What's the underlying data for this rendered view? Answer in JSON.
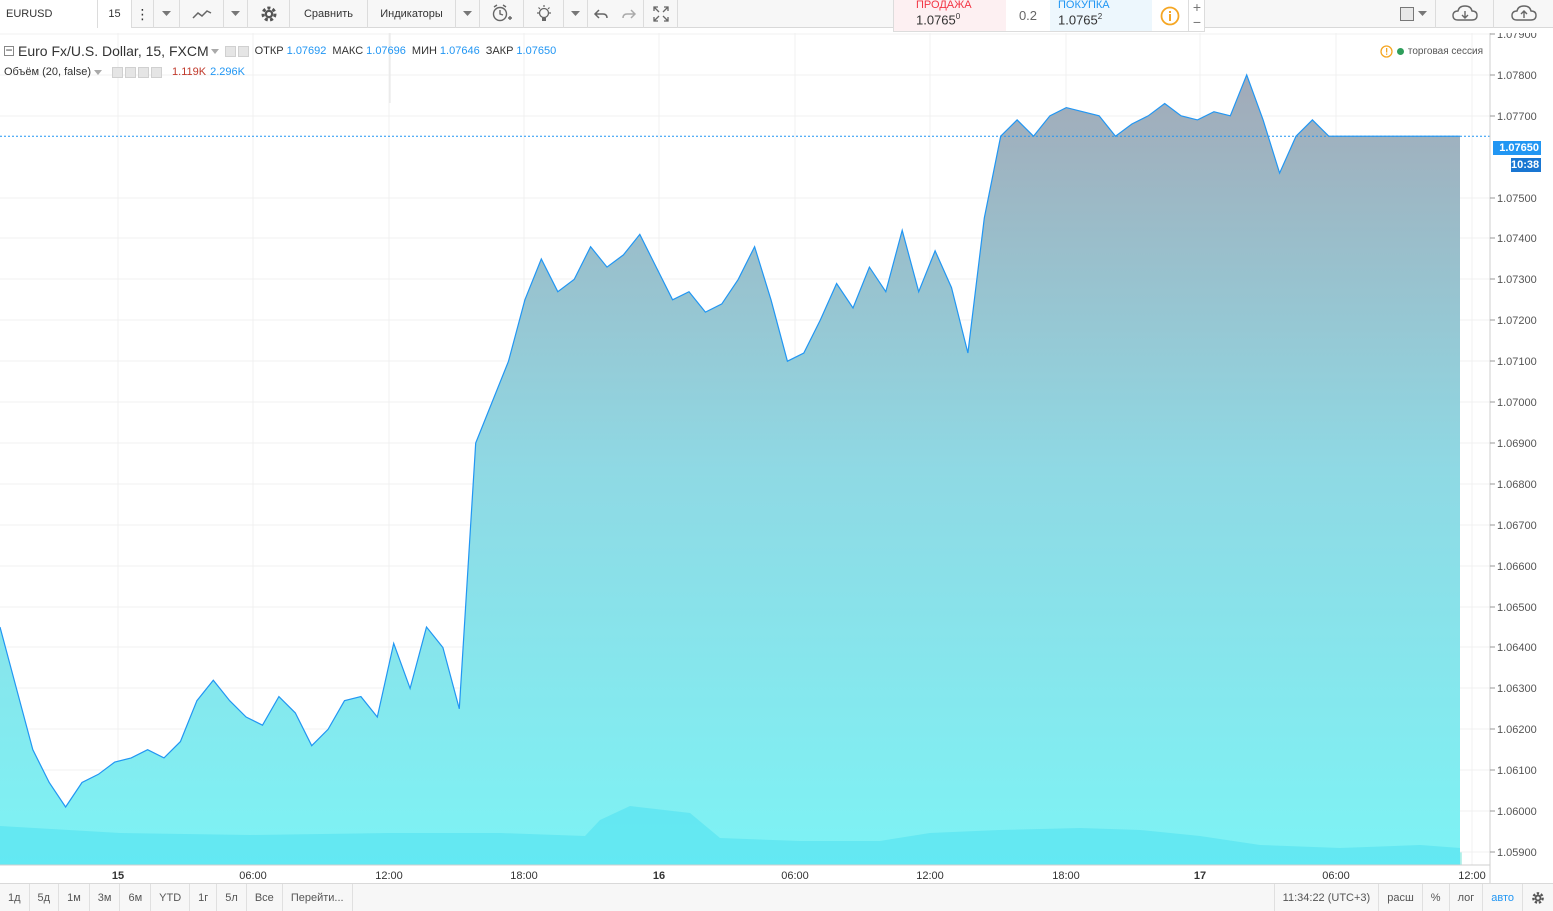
{
  "toolbar": {
    "symbol": "EURUSD",
    "interval": "15",
    "compare_label": "Сравнить",
    "indicators_label": "Индикаторы"
  },
  "quote": {
    "sell_label": "ПРОДАЖА",
    "sell_value": "1.0765",
    "sell_sup": "0",
    "spread": "0.2",
    "buy_label": "ПОКУПКА",
    "buy_value": "1.0765",
    "buy_sup": "2",
    "sell_color": "#f23645",
    "buy_color": "#2196f3"
  },
  "legend": {
    "title": "Euro Fx/U.S. Dollar, 15, FXCM",
    "open_label": "ОТКР",
    "open": "1.07692",
    "high_label": "МАКС",
    "high": "1.07696",
    "low_label": "МИН",
    "low": "1.07646",
    "close_label": "ЗАКР",
    "close": "1.07650",
    "volume_title": "Объём (20, false)",
    "volume_value_1": "1.119K",
    "volume_value_2": "2.296K",
    "session": "торговая сессия"
  },
  "price_scale": {
    "last_price": "1.07650",
    "countdown": "10:38",
    "ticks": [
      "1.07900",
      "1.07800",
      "1.07700",
      "1.07500",
      "1.07400",
      "1.07300",
      "1.07200",
      "1.07100",
      "1.07000",
      "1.06900",
      "1.06800",
      "1.06700",
      "1.06600",
      "1.06500",
      "1.06400",
      "1.06300",
      "1.06200",
      "1.06100",
      "1.06000",
      "1.05900"
    ]
  },
  "time_scale": {
    "ticks": [
      "15",
      "06:00",
      "12:00",
      "18:00",
      "16",
      "06:00",
      "12:00",
      "18:00",
      "17",
      "06:00",
      "12:00"
    ]
  },
  "bottom": {
    "ranges": [
      "1д",
      "5д",
      "1м",
      "3м",
      "6м",
      "YTD",
      "1г",
      "5л",
      "Все"
    ],
    "goto": "Перейти...",
    "clock": "11:34:22 (UTC+3)",
    "ext": "расш",
    "percent": "%",
    "log": "лог",
    "auto": "авто"
  },
  "chart_data": {
    "type": "area",
    "symbol": "EURUSD",
    "interval_minutes": 15,
    "ylim": [
      1.0588,
      1.0795
    ],
    "x": [
      "14 16:45",
      "14 17:45",
      "14 18:45",
      "14 19:45",
      "14 20:45",
      "14 21:45",
      "14 22:45",
      "14 23:45",
      "15 00:45",
      "15 01:45",
      "15 02:45",
      "15 03:45",
      "15 04:45",
      "15 05:45",
      "15 06:45",
      "15 07:45",
      "15 08:45",
      "15 09:45",
      "15 10:45",
      "15 11:45",
      "15 12:45",
      "15 13:45",
      "15 14:45",
      "15 15:45",
      "15 16:45",
      "15 17:45",
      "15 18:45",
      "15 19:45",
      "15 20:45",
      "15 21:45",
      "15 22:00",
      "15 22:15",
      "15 22:30",
      "15 22:45",
      "15 23:00",
      "15 23:15",
      "15 23:30",
      "15 23:45",
      "16 00:00",
      "16 00:30",
      "16 01:00",
      "16 01:30",
      "16 02:00",
      "16 02:30",
      "16 03:00",
      "16 04:00",
      "16 05:00",
      "16 06:00",
      "16 07:00",
      "16 08:00",
      "16 09:00",
      "16 10:00",
      "16 11:00",
      "16 11:30",
      "16 12:00",
      "16 12:30",
      "16 13:00",
      "16 14:00",
      "16 15:00",
      "16 15:30",
      "16 16:00",
      "16 17:00",
      "16 18:00",
      "16 18:30",
      "16 19:00",
      "16 20:00",
      "16 20:30",
      "16 21:00",
      "16 21:45",
      "16 22:00",
      "16 22:15",
      "16 22:30",
      "16 22:45",
      "16 23:00",
      "17 00:00",
      "17 01:00",
      "17 02:00",
      "17 03:00",
      "17 04:00",
      "17 05:00",
      "17 06:00",
      "17 07:00",
      "17 08:00",
      "17 09:00",
      "17 09:30",
      "17 10:00",
      "17 10:30",
      "17 11:00",
      "17 11:15",
      "17 11:30"
    ],
    "values": [
      1.0645,
      1.063,
      1.0615,
      1.0607,
      1.0601,
      1.0607,
      1.0609,
      1.0612,
      1.0613,
      1.0615,
      1.0613,
      1.0617,
      1.0627,
      1.0632,
      1.0627,
      1.0623,
      1.0621,
      1.0628,
      1.0624,
      1.0616,
      1.062,
      1.0627,
      1.0628,
      1.0623,
      1.0641,
      1.063,
      1.0645,
      1.064,
      1.0625,
      1.069,
      1.07,
      1.071,
      1.0725,
      1.0735,
      1.0727,
      1.073,
      1.0738,
      1.0733,
      1.0736,
      1.0741,
      1.0733,
      1.0725,
      1.0727,
      1.0722,
      1.0724,
      1.073,
      1.0738,
      1.0725,
      1.071,
      1.0712,
      1.072,
      1.0729,
      1.0723,
      1.0733,
      1.0727,
      1.0742,
      1.0727,
      1.0737,
      1.0728,
      1.0712,
      1.0745,
      1.0765,
      1.0769,
      1.0765,
      1.077,
      1.0772,
      1.0771,
      1.077,
      1.0765,
      1.0768,
      1.077,
      1.0773,
      1.077,
      1.0769,
      1.0771,
      1.077,
      1.078,
      1.0769,
      1.0756,
      1.0765,
      1.0769,
      1.0765,
      1.0765,
      1.0765,
      1.0765,
      1.0765,
      1.0765,
      1.0765,
      1.0765,
      1.0765
    ],
    "volume_ma_ylim": [
      0,
      2.5
    ],
    "grid": true,
    "line_color": "#2196f3",
    "fill_top_color": "#a2aab8",
    "fill_bottom_color": "#7df3f5"
  }
}
